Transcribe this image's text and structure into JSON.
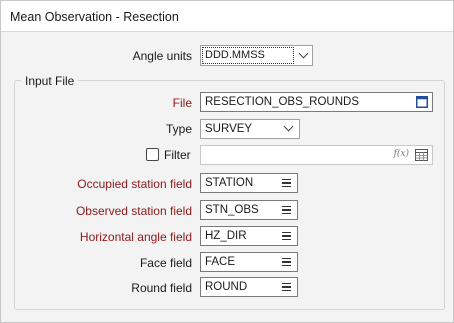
{
  "window": {
    "title": "Mean Observation - Resection"
  },
  "angle_units": {
    "label": "Angle units",
    "value": "DDD.MMSS"
  },
  "input_file": {
    "group_title": "Input File",
    "file": {
      "label": "File",
      "value": "RESECTION_OBS_ROUNDS"
    },
    "type": {
      "label": "Type",
      "value": "SURVEY"
    },
    "filter": {
      "label": "Filter",
      "value": "",
      "fx_symbol": "f(x)"
    }
  },
  "fields": {
    "occupied": {
      "label": "Occupied station field",
      "value": "STATION"
    },
    "observed": {
      "label": "Observed station field",
      "value": "STN_OBS"
    },
    "horizontal": {
      "label": "Horizontal angle field",
      "value": "HZ_DIR"
    },
    "face": {
      "label": "Face field",
      "value": "FACE"
    },
    "round": {
      "label": "Round field",
      "value": "ROUND"
    }
  },
  "colors": {
    "required_label": "#8b1a1a",
    "accent_icon": "#1f4e9c"
  }
}
